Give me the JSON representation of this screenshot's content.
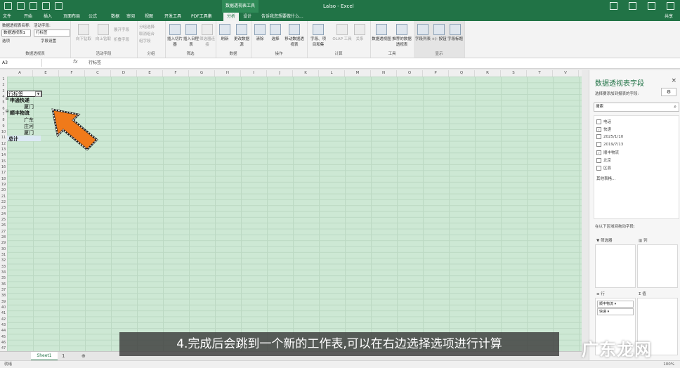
{
  "window": {
    "context_title": "数据透视表工具",
    "title": "Lalso - Excel"
  },
  "tabs": [
    "文件",
    "开始",
    "插入",
    "页面布局",
    "公式",
    "数据",
    "审阅",
    "视图",
    "开发工具",
    "PDF工具集",
    "分析",
    "设计"
  ],
  "active_tab": "分析",
  "tell_me": "告诉我您想要做什么...",
  "share": "共享",
  "ribbon": {
    "pivot_name_label": "数据透视表名称:",
    "pivot_name": "数据透视表1",
    "active_field_label": "活动字段:",
    "active_field": "行标签",
    "options_btn": "选项",
    "field_settings": "字段设置",
    "drill_down": "向下钻取",
    "drill_up": "向上钻取",
    "expand_field": "展开字段",
    "collapse_field": "折叠字段",
    "group_selection": "分组选择",
    "ungroup": "取消组合",
    "group_field": "组字段",
    "insert_slicer": "插入切片器",
    "insert_timeline": "插入日程表",
    "filter_connections": "筛选器连接",
    "refresh": "刷新",
    "change_source": "更改数据源",
    "clear": "清除",
    "select": "选择",
    "move_pivot": "移动数据透视表",
    "fields_items": "字段、项目和集",
    "olap_tools": "OLAP 工具",
    "relationships": "关系",
    "pivot_chart": "数据透视图",
    "recommended": "推荐的数据透视表",
    "field_list": "字段列表",
    "plus_minus": "+/- 按钮",
    "field_headers": "字段标题",
    "groups": {
      "pivot": "数据透视表",
      "active_field": "活动字段",
      "group": "分组",
      "filter": "筛选",
      "data": "数据",
      "actions": "操作",
      "calculations": "计算",
      "tools": "工具",
      "show": "显示"
    }
  },
  "formula_bar": {
    "name_box": "A3",
    "fx": "fx",
    "value": "行标签"
  },
  "columns": [
    "A",
    "E",
    "F",
    "C",
    "D",
    "E",
    "F",
    "G",
    "H",
    "I",
    "J",
    "K",
    "L",
    "M",
    "N",
    "O",
    "P",
    "Q",
    "R",
    "S",
    "T",
    "V"
  ],
  "rows": [
    "1",
    "2",
    "3",
    "4",
    "5",
    "6",
    "7",
    "8",
    "9",
    "10",
    "11",
    "12",
    "13",
    "14",
    "15",
    "16",
    "17",
    "18",
    "19",
    "20",
    "21",
    "22",
    "23",
    "24",
    "25",
    "26",
    "27",
    "28",
    "29",
    "30",
    "31",
    "32",
    "33",
    "34",
    "35",
    "36",
    "37",
    "38",
    "39",
    "40",
    "41",
    "42",
    "43",
    "44",
    "45",
    "46",
    "47"
  ],
  "pivot": {
    "row_label_header": "行标签",
    "items": [
      {
        "text": "申通快递",
        "level": 0,
        "bold": true
      },
      {
        "text": "厦门",
        "level": 1,
        "bold": false
      },
      {
        "text": "顺丰物流",
        "level": 0,
        "bold": true
      },
      {
        "text": "广东",
        "level": 1,
        "bold": false
      },
      {
        "text": "庄河",
        "level": 1,
        "bold": false
      },
      {
        "text": "厦门",
        "level": 1,
        "bold": false
      }
    ],
    "total": "总计"
  },
  "sheets": {
    "tab": "Sheet1",
    "add": "1",
    "plus": "⊕"
  },
  "status": {
    "ready": "就绪",
    "zoom": "100%"
  },
  "pane": {
    "title": "数据透视表字段",
    "subtitle": "选择要添加到报表的字段:",
    "search_placeholder": "搜索",
    "fields": [
      {
        "name": "电话",
        "checked": false
      },
      {
        "name": "快递",
        "checked": true
      },
      {
        "name": "2025/1/10",
        "checked": false
      },
      {
        "name": "2019/7/13",
        "checked": false
      },
      {
        "name": "顺丰物流",
        "checked": true
      },
      {
        "name": "北京",
        "checked": false
      },
      {
        "name": "区县",
        "checked": false
      }
    ],
    "more_tables": "其他表格...",
    "drag_hint": "在以下区域间拖动字段:",
    "areas": {
      "filters": "筛选器",
      "columns": "列",
      "rows": "行",
      "values": "值"
    },
    "row_chips": [
      "顺丰物流",
      "快递"
    ]
  },
  "caption": "4.完成后会跳到一个新的工作表,可以在右边选择选项进行计算",
  "watermark": "广东龙网",
  "colors": {
    "excel_green": "#217346",
    "sheet_background": "#cde8d4",
    "arrow_orange": "#f07a1a",
    "caption_bg": "#3c3c3c"
  }
}
